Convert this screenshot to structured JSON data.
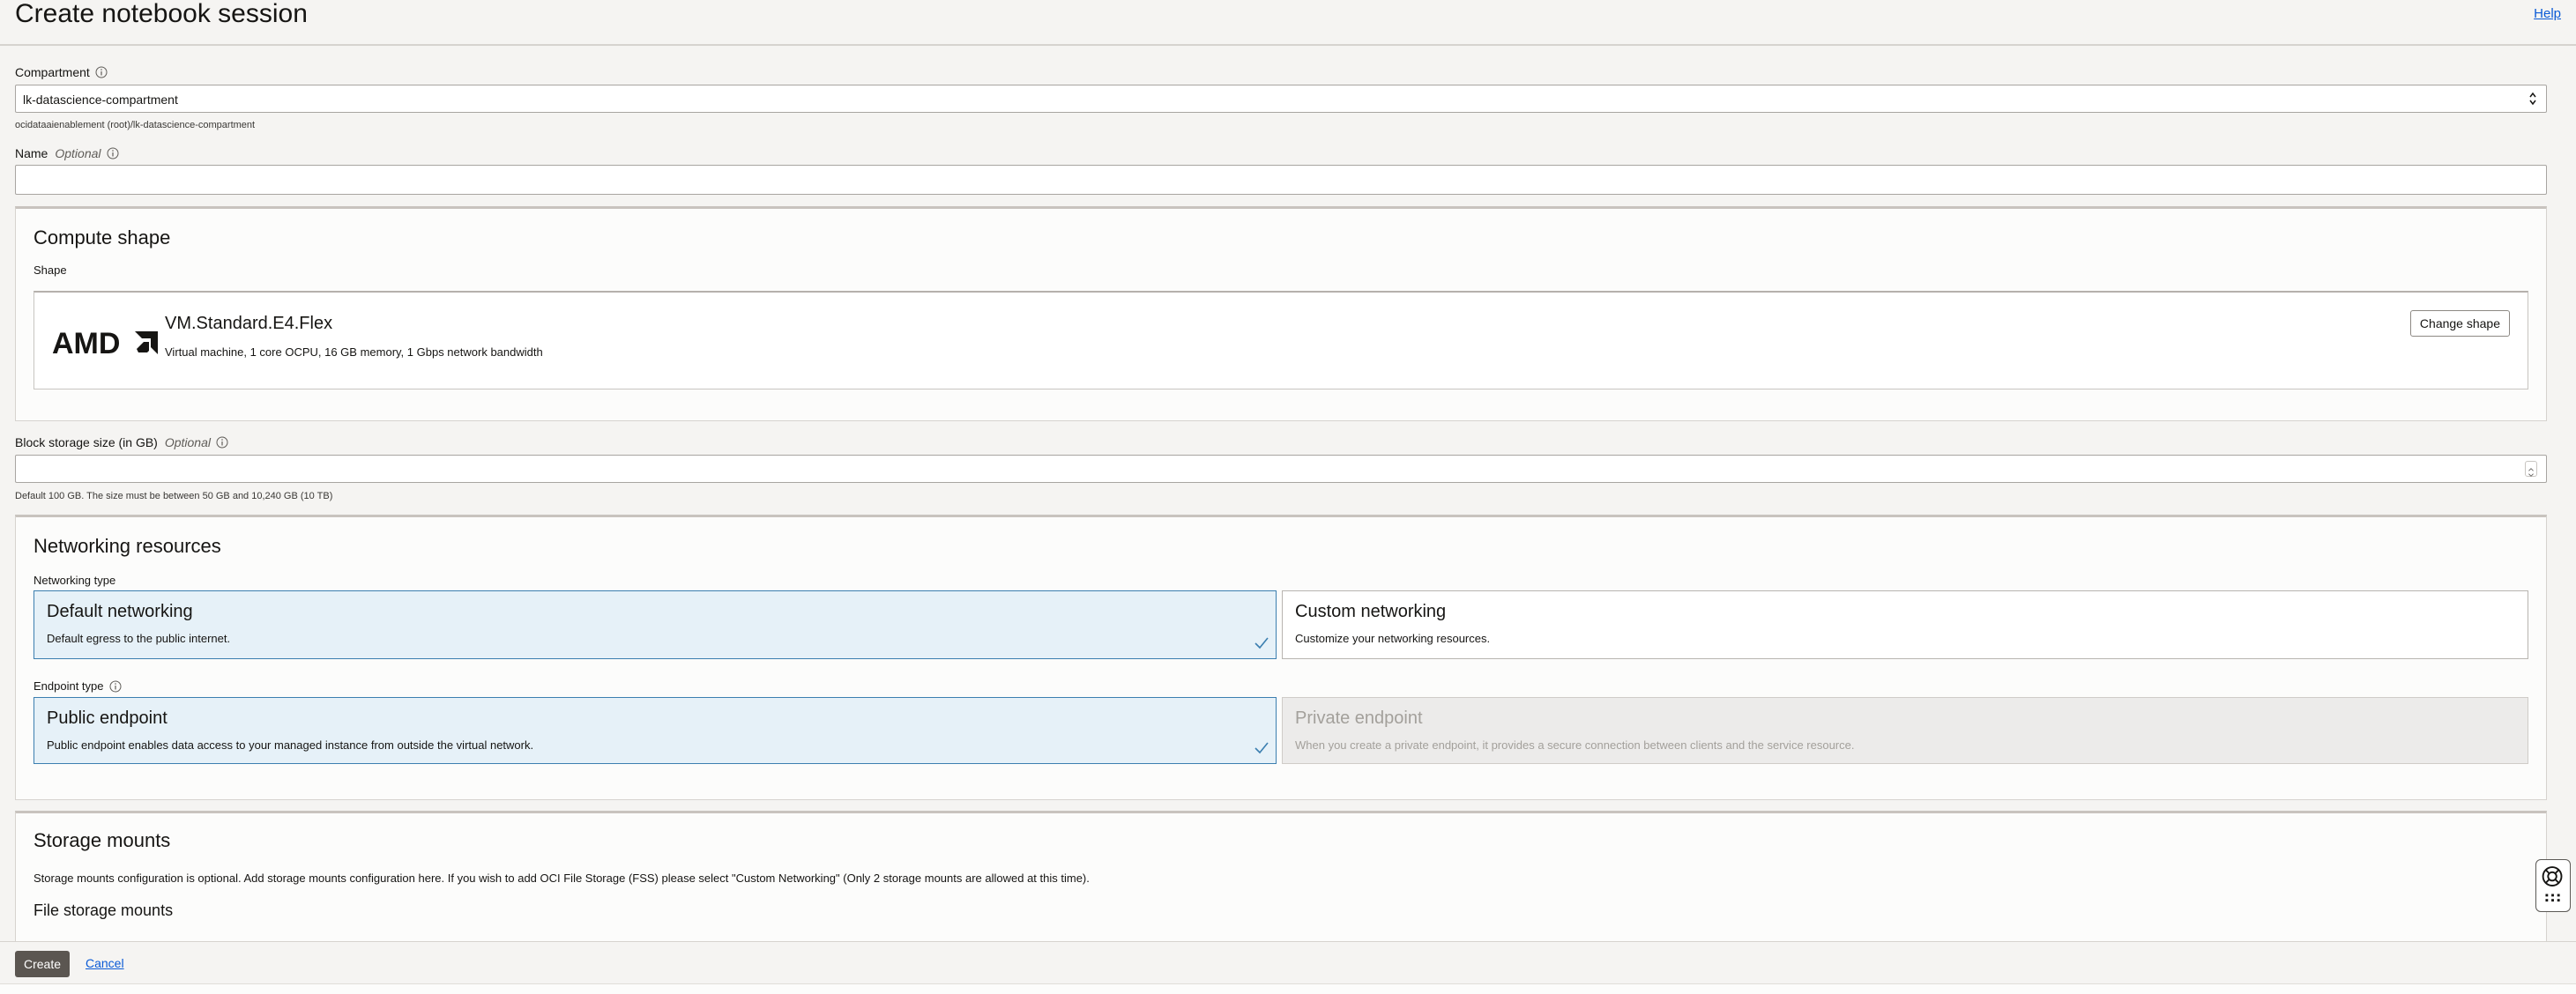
{
  "header": {
    "title": "Create notebook session",
    "help_link": "Help"
  },
  "compartment": {
    "label": "Compartment",
    "value": "lk-datascience-compartment",
    "path": "ocidataaienablement (root)/lk-datascience-compartment"
  },
  "name_field": {
    "label": "Name",
    "optional": "Optional",
    "value": ""
  },
  "compute_shape": {
    "title": "Compute shape",
    "shape_label": "Shape",
    "vendor_logo": "AMD",
    "shape_name": "VM.Standard.E4.Flex",
    "shape_desc": "Virtual machine, 1 core OCPU, 16 GB memory, 1 Gbps network bandwidth",
    "change_button": "Change shape"
  },
  "block_storage": {
    "label": "Block storage size (in GB)",
    "optional": "Optional",
    "value": "",
    "help": "Default 100 GB. The size must be between 50 GB and 10,240 GB (10 TB)"
  },
  "networking": {
    "title": "Networking resources",
    "type_label": "Networking type",
    "default": {
      "title": "Default networking",
      "desc": "Default egress to the public internet.",
      "selected": true
    },
    "custom": {
      "title": "Custom networking",
      "desc": "Customize your networking resources.",
      "selected": false
    },
    "endpoint_label": "Endpoint type",
    "public": {
      "title": "Public endpoint",
      "desc": "Public endpoint enables data access to your managed instance from outside the virtual network.",
      "selected": true
    },
    "private": {
      "title": "Private endpoint",
      "desc": "When you create a private endpoint, it provides a secure connection between clients and the service resource.",
      "disabled": true
    }
  },
  "storage_mounts": {
    "title": "Storage mounts",
    "desc": "Storage mounts configuration is optional. Add storage mounts configuration here. If you wish to add OCI File Storage (FSS) please select \"Custom Networking\" (Only 2 storage mounts are allowed at this time).",
    "file_storage_label": "File storage mounts"
  },
  "footer": {
    "create": "Create",
    "cancel": "Cancel"
  },
  "colors": {
    "selected_bg": "#e6f1f8",
    "selected_border": "#3c7fb0",
    "link": "#0a5ad6",
    "primary_button": "#5b5651"
  }
}
